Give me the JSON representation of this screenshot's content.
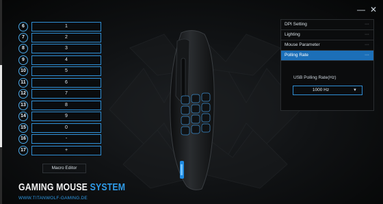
{
  "window_controls": {
    "minimize": "—",
    "close": "✕"
  },
  "key_rows": [
    {
      "num": "6",
      "value": "1"
    },
    {
      "num": "7",
      "value": "2"
    },
    {
      "num": "8",
      "value": "3"
    },
    {
      "num": "9",
      "value": "4"
    },
    {
      "num": "10",
      "value": "5"
    },
    {
      "num": "11",
      "value": "6"
    },
    {
      "num": "12",
      "value": "7"
    },
    {
      "num": "13",
      "value": "8"
    },
    {
      "num": "14",
      "value": "9"
    },
    {
      "num": "15",
      "value": "0"
    },
    {
      "num": "16",
      "value": "-"
    },
    {
      "num": "17",
      "value": "+"
    }
  ],
  "macro_editor_label": "Macro Editor",
  "brand": {
    "main": "GAMING MOUSE",
    "accent": "SYSTEM",
    "url": "WWW.TITANWOLF-GAMING.DE"
  },
  "settings_panel": {
    "items": [
      {
        "label": "DPI Setting",
        "dots": "···"
      },
      {
        "label": "Lighting",
        "dots": "···"
      },
      {
        "label": "Mouse Parameter",
        "dots": "···"
      },
      {
        "label": "Polling Rate",
        "dots": "···"
      }
    ],
    "usb_label": "USB Polling Rate(Hz)",
    "usb_value": "1000 Hz",
    "usb_chevron": "▼"
  },
  "colors": {
    "accent": "#2f9be8",
    "active_item": "#1c6fb8",
    "field_border": "#2f8fd6"
  }
}
